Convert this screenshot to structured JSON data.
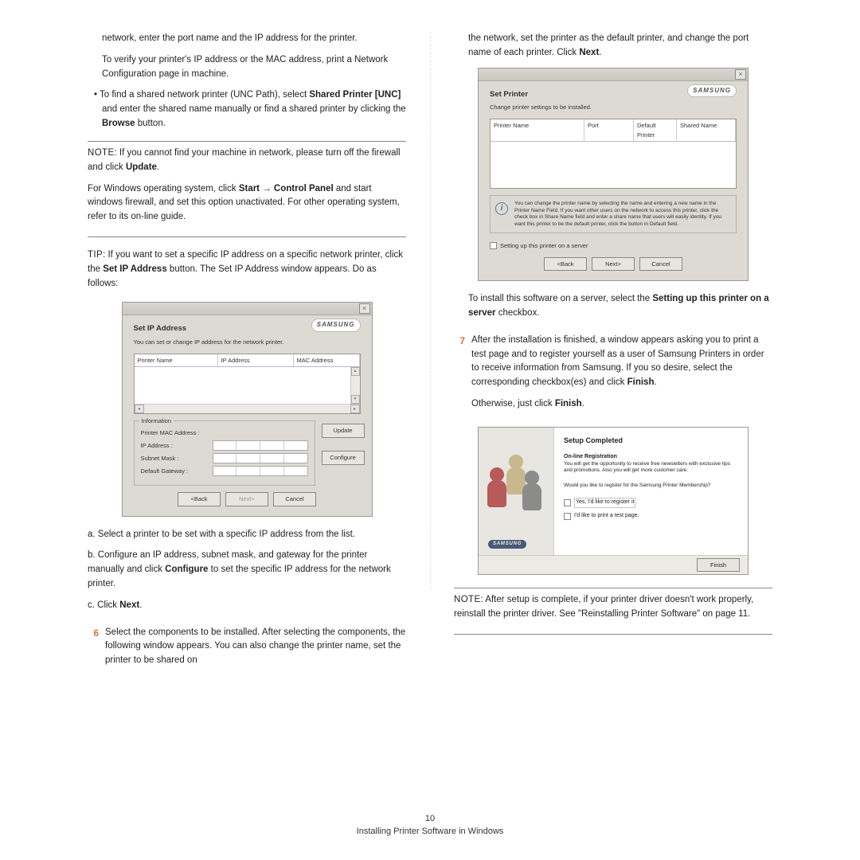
{
  "left": {
    "p1": "network, enter the port name and the IP address for the printer.",
    "p2": "To verify your printer's IP address or the MAC address, print a Network Configuration page in machine.",
    "p3a": "To find a shared network printer (UNC Path), select ",
    "p3b": "Shared Printer [UNC]",
    "p3c": " and enter the shared name manually or find a shared printer by clicking the ",
    "p3d": "Browse",
    "p3e": " button.",
    "note_label": "NOTE",
    "note_1": ": If you cannot find your machine in network, please turn off the firewall and click ",
    "note_1b": "Update",
    "note_1c": ".",
    "note_2a": "For Windows operating system, click ",
    "note_2b": "Start",
    "note_2c": " → ",
    "note_2d": "Control Panel",
    "note_2e": " and start windows firewall, and set this option unactivated. For other operating system, refer to its on-line guide.",
    "tip_label": "TIP",
    "tip_a": ": If you want to set a specific IP address on a specific network printer, click the ",
    "tip_b": "Set IP Address",
    "tip_c": " button. The Set IP Address window appears. Do as follows:",
    "a": "a. Select a printer to be set with a specific IP address from the list.",
    "b": "b. Configure an IP address, subnet mask, and gateway for the printer manually and click ",
    "b2": "Configure",
    "b3": " to set the specific IP address for the network printer.",
    "c": "c. Click ",
    "c2": "Next",
    "c3": ".",
    "step6": "Select the components to be installed. After selecting the components, the following window appears. You can also change the printer name, set the printer to be shared on"
  },
  "right": {
    "p1": "the network, set the printer as the default printer, and change the port name of each printer. Click ",
    "p1b": "Next",
    "p1c": ".",
    "install_a": "To install this software on a server, select the ",
    "install_b": "Setting up this printer on a server",
    "install_c": " checkbox.",
    "step7a": "After the installation is finished, a window appears asking you to print a test page and to register yourself as a user of Samsung Printers in order to receive information from Samsung. If you so desire, select the corresponding checkbox(es) and click ",
    "step7b": "Finish",
    "step7c": ".",
    "otherwise_a": "Otherwise, just click ",
    "otherwise_b": "Finish",
    "otherwise_c": ".",
    "note2_label": "NOTE",
    "note2": ": After setup is complete, if your printer driver doesn't work properly, reinstall the printer driver. See \"Reinstalling Printer Software\" on page 11."
  },
  "dlg_ip": {
    "title": "Set IP Address",
    "subtitle": "You can set or change IP address for the network printer.",
    "brand": "SAMSUNG",
    "col1": "Printer Name",
    "col2": "IP Address",
    "col3": "MAC Address",
    "grp": "Information",
    "f1": "Printer MAC Address :",
    "f2": "IP Address :",
    "f3": "Subnet Mask :",
    "f4": "Default Gateway :",
    "update": "Update",
    "configure": "Configure",
    "back": "<Back",
    "next": "Next>",
    "cancel": "Cancel"
  },
  "dlg_set": {
    "title": "Set Printer",
    "subtitle": "Change printer settings to be installed.",
    "brand": "SAMSUNG",
    "c1": "Printer Name",
    "c2": "Port",
    "c3": "Default Printer",
    "c4": "Shared Name",
    "info": "You can change the printer name by selecting the name and entering a new name in the Printer Name Field. If you want other users on the network to access this printer, click the check box in Share Name field and enter a share name that users will easily identity. If you want this printer to be the default printer, click the button in Default field.",
    "chk": "Setting up this printer on a server",
    "back": "<Back",
    "next": "Next>",
    "cancel": "Cancel"
  },
  "dlg_done": {
    "title": "Setup Completed",
    "reg_h": "On-line Registration",
    "reg_t": "You will get the opportunity to receive free newsletters with exclusive tips and promotions. Also you will get more customer care.",
    "q": "Would you like to register for the Samsung Printer Membership?",
    "opt1": "Yes, I'd like to register it",
    "opt2": "I'd like to print a test page.",
    "brand": "SAMSUNG",
    "finish": "Finish"
  },
  "footer": {
    "page": "10",
    "title": "Installing Printer Software in Windows"
  },
  "nums": {
    "six": "6",
    "seven": "7"
  }
}
